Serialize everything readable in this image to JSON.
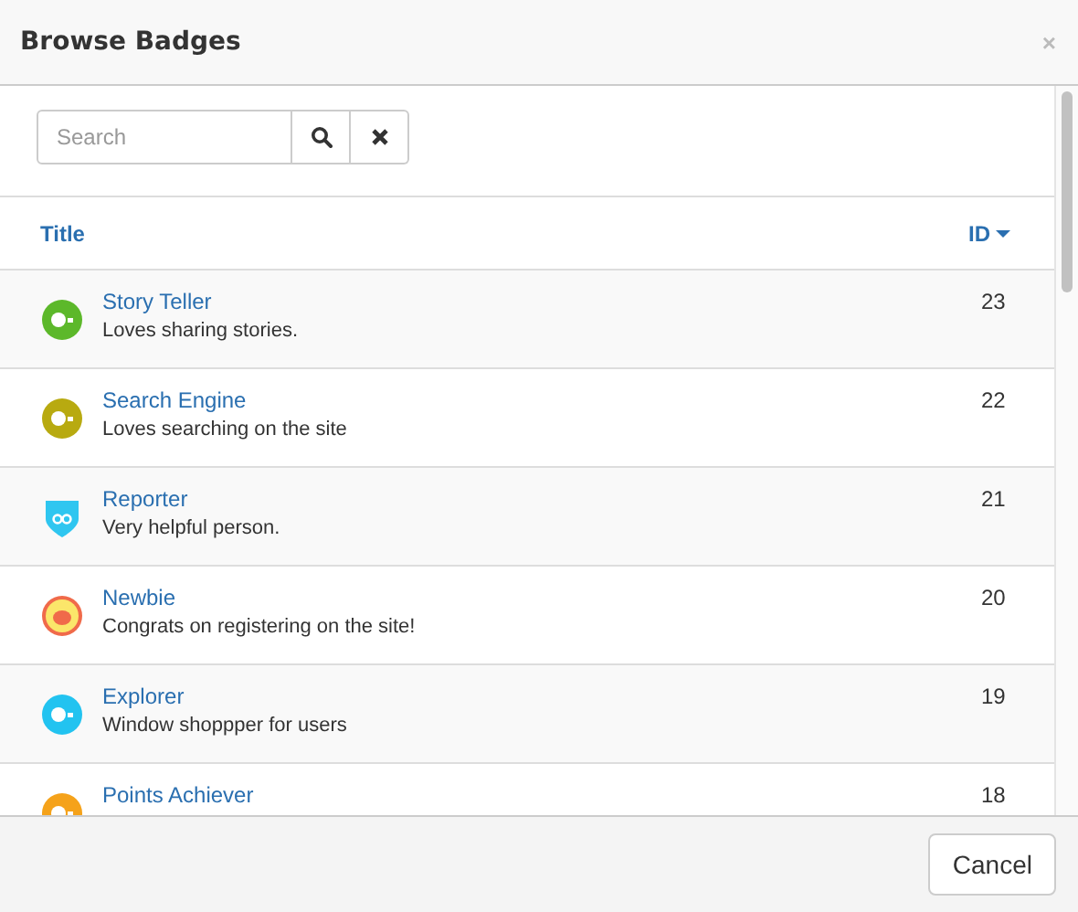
{
  "dialog": {
    "title": "Browse Badges",
    "close": "×"
  },
  "search": {
    "placeholder": "Search"
  },
  "table": {
    "columns": [
      {
        "label": "Title",
        "sorted": false
      },
      {
        "label": "ID",
        "sorted": true
      }
    ],
    "rows": [
      {
        "title": "Story Teller",
        "description": "Loves sharing stories.",
        "id": "23",
        "kind": "circle",
        "color": "#5cb82a"
      },
      {
        "title": "Search Engine",
        "description": "Loves searching on the site",
        "id": "22",
        "kind": "circle",
        "color": "#b8aa10"
      },
      {
        "title": "Reporter",
        "description": "Very helpful person.",
        "id": "21",
        "kind": "shield",
        "color": "#2fc6f0"
      },
      {
        "title": "Newbie",
        "description": "Congrats on registering on the site!",
        "id": "20",
        "kind": "ring",
        "color": "#f06a4a"
      },
      {
        "title": "Explorer",
        "description": "Window shoppper for users",
        "id": "19",
        "kind": "circle",
        "color": "#22c3f0"
      },
      {
        "title": "Points Achiever",
        "id": "18",
        "kind": "circle",
        "color": "#f5a21a"
      }
    ]
  },
  "footer": {
    "buttons": [
      "Cancel"
    ]
  }
}
